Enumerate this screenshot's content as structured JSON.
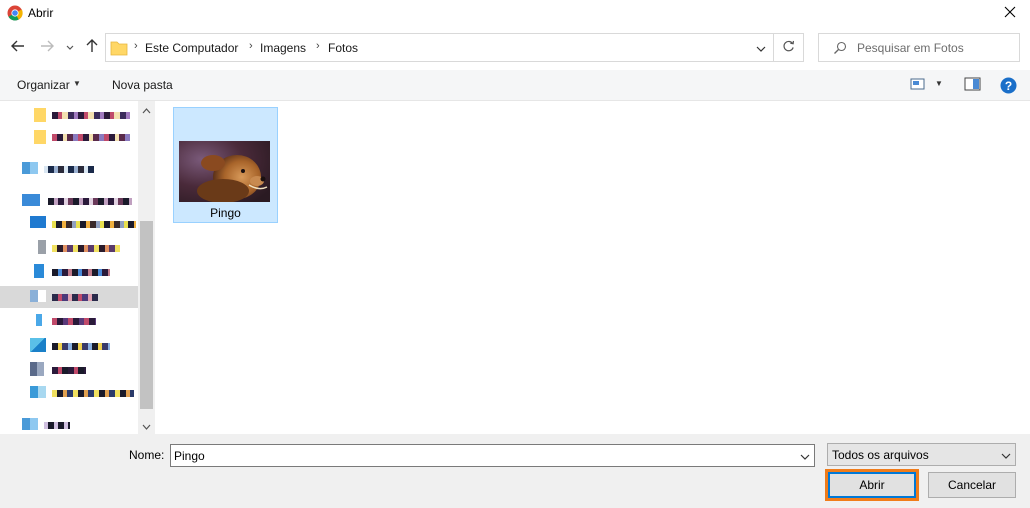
{
  "window": {
    "title": "Abrir",
    "app_icon": "chrome-icon",
    "close_icon": "close-icon"
  },
  "navigation": {
    "back_icon": "arrow-left-icon",
    "forward_icon": "arrow-right-icon",
    "recent_icon": "chevron-down-icon",
    "up_icon": "arrow-up-icon",
    "breadcrumb": [
      "Este Computador",
      "Imagens",
      "Fotos"
    ],
    "refresh_icon": "refresh-icon"
  },
  "search": {
    "placeholder": "Pesquisar em Fotos",
    "value": ""
  },
  "toolbar": {
    "organize_label": "Organizar",
    "new_folder_label": "Nova pasta",
    "view_icon": "view-options-icon",
    "preview_icon": "preview-pane-icon",
    "help_icon": "help-icon",
    "help_glyph": "?"
  },
  "sidebar": {
    "items": [
      {
        "kind": "folder",
        "selected": false
      },
      {
        "kind": "folder",
        "selected": false
      },
      {
        "kind": "network",
        "selected": false
      },
      {
        "kind": "computer",
        "selected": false
      },
      {
        "kind": "desktop",
        "selected": false
      },
      {
        "kind": "documents",
        "selected": false
      },
      {
        "kind": "downloads",
        "selected": false
      },
      {
        "kind": "pictures",
        "selected": true
      },
      {
        "kind": "music",
        "selected": false
      },
      {
        "kind": "objects",
        "selected": false
      },
      {
        "kind": "videos",
        "selected": false
      },
      {
        "kind": "drive",
        "selected": false
      },
      {
        "kind": "network",
        "selected": false
      }
    ]
  },
  "files": [
    {
      "name": "Pingo",
      "type": "image",
      "selected": true
    }
  ],
  "bottom": {
    "name_label": "Nome:",
    "name_value": "Pingo",
    "file_type": "Todos os arquivos",
    "open_label": "Abrir",
    "cancel_label": "Cancelar"
  },
  "colors": {
    "selection_bg": "#cce8ff",
    "selection_border": "#99d1ff",
    "highlight": "#f07c1a",
    "focus": "#0078d7"
  }
}
